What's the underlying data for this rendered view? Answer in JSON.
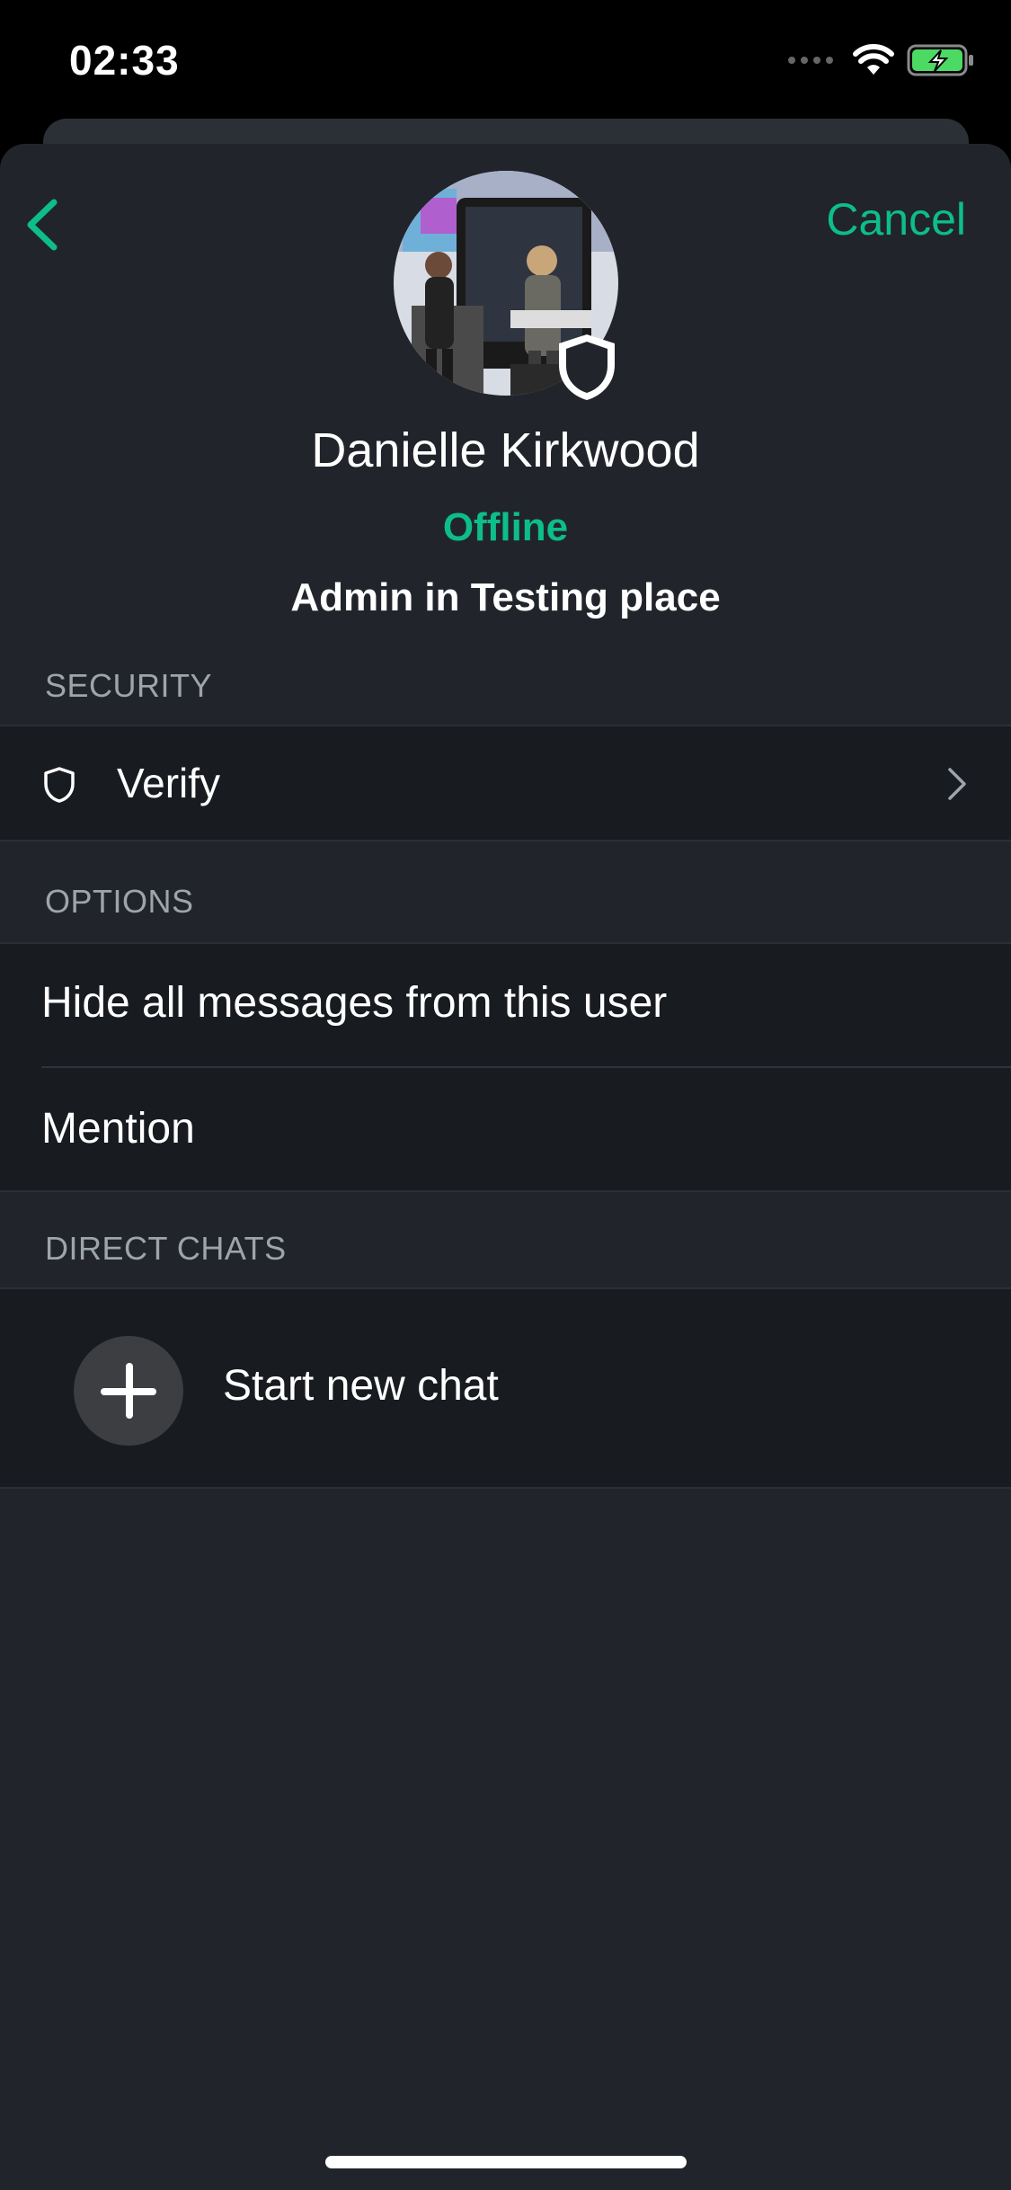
{
  "status_bar": {
    "time": "02:33"
  },
  "header": {
    "cancel_label": "Cancel"
  },
  "profile": {
    "display_name": "Danielle Kirkwood",
    "presence": "Offline",
    "power_level": "Admin in Testing place"
  },
  "sections": {
    "security": {
      "header": "SECURITY",
      "verify_label": "Verify"
    },
    "options": {
      "header": "OPTIONS",
      "items": [
        "Hide all messages from this user",
        "Mention"
      ]
    },
    "direct_chats": {
      "header": "DIRECT CHATS",
      "start_label": "Start new chat"
    }
  },
  "colors": {
    "accent": "#0dbd8b",
    "background": "#21252b",
    "row_background": "#181b20",
    "secondary_text": "#9ea4ad"
  }
}
